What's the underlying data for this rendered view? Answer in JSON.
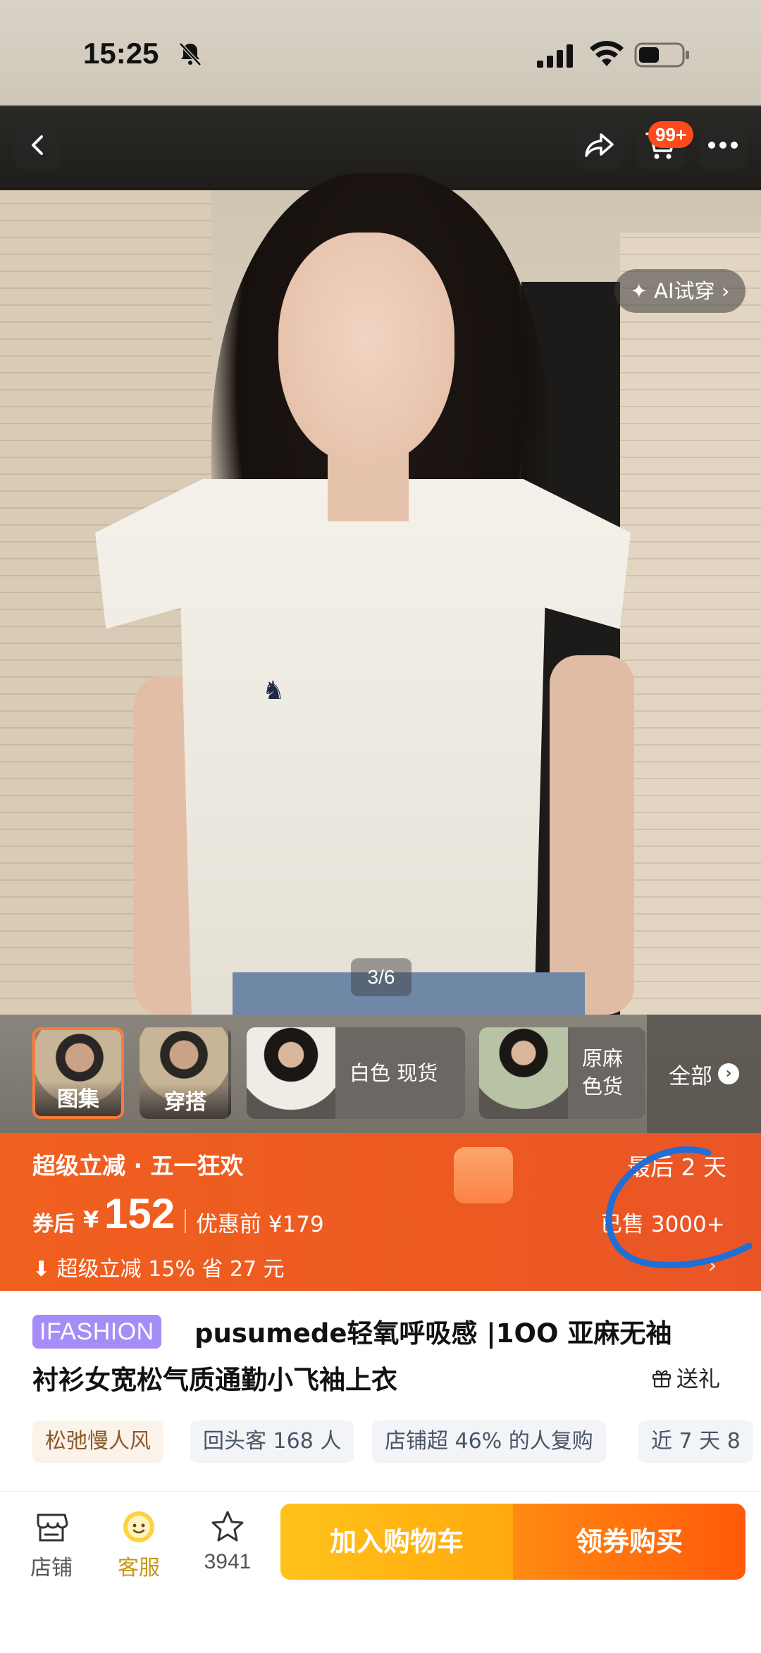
{
  "status": {
    "time": "15:25"
  },
  "nav": {
    "cart_badge": "99+"
  },
  "hero": {
    "ai_tryon": "✦ AI试穿 ›",
    "pager": "3/6"
  },
  "thumbs": [
    {
      "caption": "图集"
    },
    {
      "caption": "穿搭"
    },
    {
      "label": "白色 现货"
    },
    {
      "label": "原麻色货"
    }
  ],
  "view_all": "全部",
  "promo": {
    "title": "超级立减 · 五一狂欢",
    "countdown": "最后 2 天",
    "price_prefix": "券后",
    "currency": "¥",
    "price": "152",
    "before_price": "优惠前 ¥179",
    "sold": "已售 3000+",
    "saving": "⬇ 超级立减 15% 省 27 元"
  },
  "product": {
    "brand_tag": "IFASHION",
    "title_line1": "pusumede轻氧呼吸感 |1OO 亚麻无袖",
    "title_line2": "衬衫女宽松气质通勤小飞袖上衣",
    "gift": "送礼"
  },
  "tags": [
    "松弛慢人风",
    "回头客 168 人",
    "店铺超 46% 的人复购",
    "近 7 天 8"
  ],
  "bottom": {
    "store": "店铺",
    "service": "客服",
    "favorites": "3941",
    "add_cart": "加入购物车",
    "buy": "领券购买"
  },
  "colors": {
    "promo_orange": "#ec5a22",
    "brand_purple": "#a58cf6",
    "cart_yellow": "#ffb30f",
    "buy_orange": "#ff6a0a",
    "scribble_blue": "#1f6fd6"
  }
}
